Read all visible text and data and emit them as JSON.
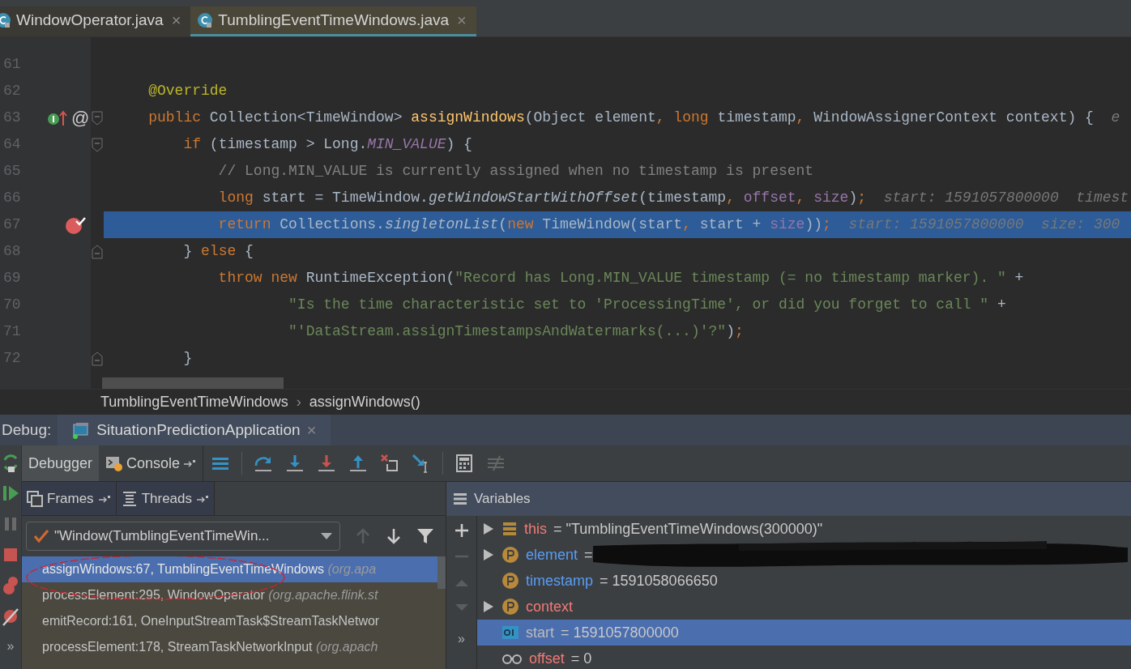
{
  "editor_tabs": [
    {
      "label": "WindowOperator.java",
      "selected": false,
      "close": "×"
    },
    {
      "label": "TumblingEventTimeWindows.java",
      "selected": true,
      "close": "×"
    }
  ],
  "code_lines": [
    {
      "number": "61"
    },
    {
      "number": "62",
      "tokens": [
        {
          "kind": "a",
          "s": "    @Override"
        }
      ]
    },
    {
      "number": "63",
      "fold_start": true,
      "implements_mark": true,
      "gutter_text": "@",
      "tokens": [
        {
          "kind": "k",
          "s": "    public"
        },
        {
          "kind": "p",
          "s": " Collection<TimeWindow> "
        },
        {
          "kind": "m",
          "s": "assignWindows"
        },
        {
          "kind": "p",
          "s": "(Object element"
        },
        {
          "kind": "k",
          "s": ","
        },
        {
          "kind": "k",
          "s": " long"
        },
        {
          "kind": "p",
          "s": " timestamp"
        },
        {
          "kind": "k",
          "s": ","
        },
        {
          "kind": "p",
          "s": " WindowAssignerContext context) {"
        },
        {
          "kind": "h",
          "s": "  e"
        }
      ]
    },
    {
      "number": "64",
      "fold_start": true,
      "tokens": [
        {
          "kind": "k",
          "s": "        if"
        },
        {
          "kind": "p",
          "s": " (timestamp > Long."
        },
        {
          "kind": "n",
          "s": "MIN_VALUE"
        },
        {
          "kind": "p",
          "s": ") {"
        }
      ]
    },
    {
      "number": "65",
      "tokens": [
        {
          "kind": "c",
          "s": "            // Long.MIN_VALUE is currently assigned when no timestamp is present"
        }
      ]
    },
    {
      "number": "66",
      "tokens": [
        {
          "kind": "k",
          "s": "            long"
        },
        {
          "kind": "p",
          "s": " start = TimeWindow."
        },
        {
          "kind": "i",
          "s": "getWindowStartWithOffset"
        },
        {
          "kind": "p",
          "s": "(timestamp"
        },
        {
          "kind": "k",
          "s": ","
        },
        {
          "kind": "f",
          "s": " offset"
        },
        {
          "kind": "k",
          "s": ","
        },
        {
          "kind": "f",
          "s": " size"
        },
        {
          "kind": "p",
          "s": ")"
        },
        {
          "kind": "k",
          "s": ";"
        },
        {
          "kind": "h",
          "s": "  start: 1591057800000  timest"
        }
      ]
    },
    {
      "number": "67",
      "execution_point": true,
      "breakpoint": true,
      "tokens": [
        {
          "kind": "k",
          "s": "            return"
        },
        {
          "kind": "p",
          "s": " Collections."
        },
        {
          "kind": "i",
          "s": "singletonList"
        },
        {
          "kind": "p",
          "s": "("
        },
        {
          "kind": "k",
          "s": "new"
        },
        {
          "kind": "p",
          "s": " TimeWindow(start"
        },
        {
          "kind": "k",
          "s": ","
        },
        {
          "kind": "p",
          "s": " start + "
        },
        {
          "kind": "f",
          "s": "size"
        },
        {
          "kind": "p",
          "s": "))"
        },
        {
          "kind": "k",
          "s": ";"
        },
        {
          "kind": "h",
          "s": "  start: 1591057800000  size: 300"
        }
      ]
    },
    {
      "number": "68",
      "fold_end": true,
      "tokens": [
        {
          "kind": "p",
          "s": "        } "
        },
        {
          "kind": "k",
          "s": "else"
        },
        {
          "kind": "p",
          "s": " {"
        }
      ]
    },
    {
      "number": "69",
      "tokens": [
        {
          "kind": "k",
          "s": "            throw new"
        },
        {
          "kind": "p",
          "s": " RuntimeException("
        },
        {
          "kind": "s",
          "s": "\"Record has Long.MIN_VALUE timestamp (= no timestamp marker). \""
        },
        {
          "kind": "p",
          "s": " +"
        }
      ]
    },
    {
      "number": "70",
      "tokens": [
        {
          "kind": "s",
          "s": "                    \"Is the time characteristic set to 'ProcessingTime', or did you forget to call \""
        },
        {
          "kind": "p",
          "s": " +"
        }
      ]
    },
    {
      "number": "71",
      "tokens": [
        {
          "kind": "s",
          "s": "                    \"'DataStream.assignTimestampsAndWatermarks(...)'?\""
        },
        {
          "kind": "p",
          "s": ")"
        },
        {
          "kind": "k",
          "s": ";"
        }
      ]
    },
    {
      "number": "72",
      "fold_end": true,
      "tokens": [
        {
          "kind": "p",
          "s": "        }"
        }
      ]
    }
  ],
  "breadcrumbs": {
    "items": [
      "TumblingEventTimeWindows",
      "assignWindows()"
    ],
    "separator": "›"
  },
  "debug": {
    "label": "Debug:",
    "session_tab": {
      "label": "SituationPredictionApplication",
      "close": "×"
    },
    "tabs": [
      {
        "label": "Debugger",
        "selected": true
      },
      {
        "label": "Console",
        "selected": false
      }
    ]
  },
  "frames": {
    "tabs": [
      {
        "label": "Frames",
        "selected": false
      },
      {
        "label": "Threads",
        "selected": false
      }
    ],
    "thread": "\"Window(TumblingEventTimeWin...",
    "rows": [
      {
        "method": "assignWindows:67, TumblingEventTimeWindows",
        "location": "(org.apa",
        "selected": true
      },
      {
        "method": "processElement:295, WindowOperator",
        "location": "(org.apache.flink.st",
        "selected": false
      },
      {
        "method": "emitRecord:161, OneInputStreamTask$StreamTaskNetwor",
        "selected": false
      },
      {
        "method": "processElement:178, StreamTaskNetworkInput",
        "location": "(org.apach",
        "selected": false
      }
    ]
  },
  "variables": {
    "title": "Variables",
    "side_more": "»",
    "left_more": "»",
    "rows": [
      {
        "kind": "object",
        "expandable": true,
        "name": "this",
        "color": "#f07a78",
        "value": "= \"TumblingEventTimeWindows(300000)\"",
        "selected": false
      },
      {
        "kind": "param",
        "expandable": true,
        "name": "element",
        "color": "#589df6",
        "value": "=",
        "redacted": true,
        "selected": false
      },
      {
        "kind": "param",
        "expandable": false,
        "name": "timestamp",
        "color": "#589df6",
        "value": "= 1591058066650",
        "selected": false
      },
      {
        "kind": "param",
        "expandable": true,
        "name": "context",
        "color": "#f07a78",
        "selected": false
      },
      {
        "kind": "local",
        "expandable": false,
        "name": "start",
        "color": "#bbbbbb",
        "value": "= 1591057800000",
        "selected": true
      },
      {
        "kind": "watch",
        "expandable": false,
        "name": "offset",
        "color": "#f07a78",
        "value": "= 0",
        "selected": false
      }
    ]
  }
}
